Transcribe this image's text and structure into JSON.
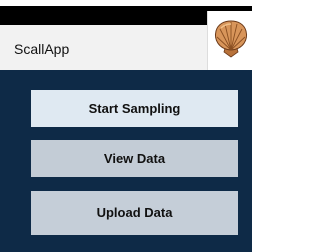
{
  "app": {
    "title": "ScallApp",
    "logo_icon": "scallop-shell-icon",
    "colors": {
      "background": "#0e2a47",
      "app_bar": "#f2f2f2",
      "status_bar": "#000000"
    }
  },
  "main": {
    "buttons": [
      {
        "label": "Start Sampling"
      },
      {
        "label": "View Data"
      },
      {
        "label": "Upload Data"
      }
    ]
  }
}
